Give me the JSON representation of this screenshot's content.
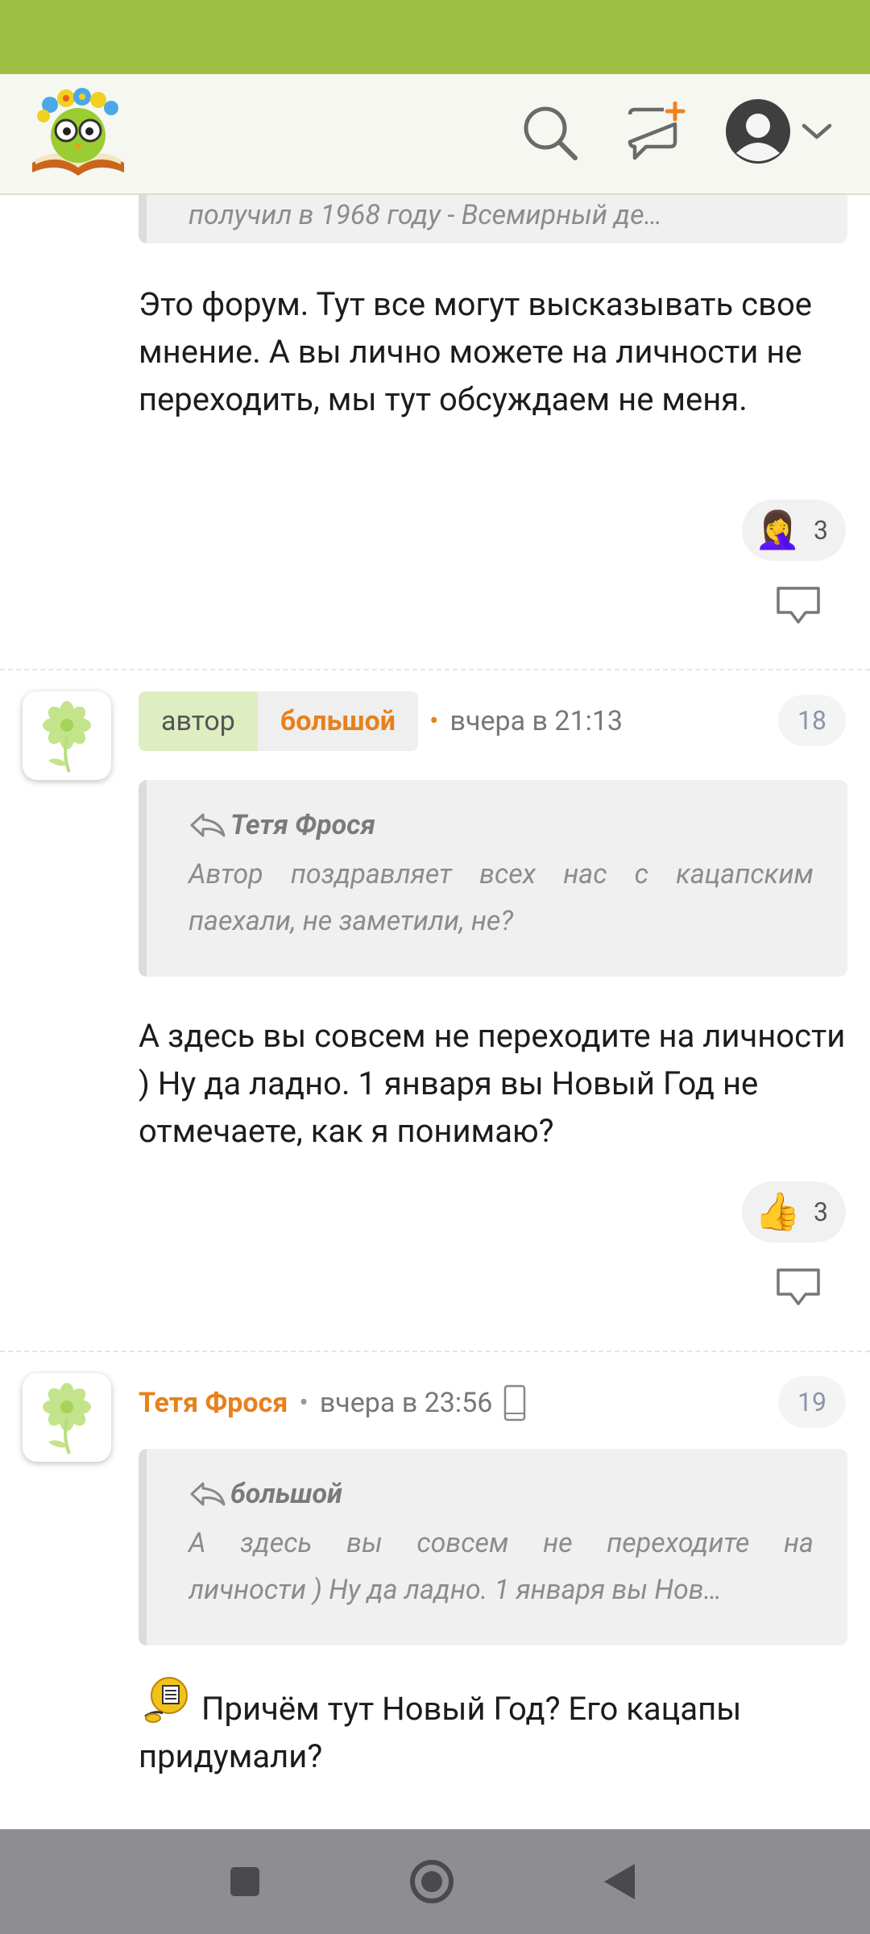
{
  "header": {
    "logo": "owl-books-logo",
    "icons": [
      "search-icon",
      "new-topic-icon",
      "avatar-icon",
      "chevron-down-icon"
    ]
  },
  "posts": [
    {
      "quote_text": "получил в 1968 году - Всемирный де…",
      "body": "Это форум. Тут все могут высказывать свое мнение. А вы лично можете на личности не переходить, мы тут обсуждаем не меня.",
      "reaction": {
        "emoji": "🤦‍♀️",
        "count": "3"
      }
    },
    {
      "badge_role": "автор",
      "author": "большой",
      "time": "вчера в 21:13",
      "number": "18",
      "quote_author": "Тетя Фрося",
      "quote_text": "Автор поздравляет всех нас с кацапским паехали, не заметили, не?",
      "body": "А здесь вы совсем не переходите на личности ) Ну да ладно. 1 января вы Новый Год не отмечаете, как я понимаю?",
      "reaction": {
        "emoji": "👍",
        "count": "3"
      }
    },
    {
      "author": "Тетя Фрося",
      "time": "вчера в 23:56",
      "number": "19",
      "quote_author": "большой",
      "quote_text_line1": "А здесь вы совсем не переходите на",
      "quote_text_line2": "личности ) Ну да ладно. 1 января вы Нов…",
      "body": "Причём тут Новый Год? Его кацапы придумали?"
    }
  ],
  "colors": {
    "status_bar": "#9dc044",
    "accent": "#e8801c",
    "header_bg": "#f7f7f1"
  }
}
